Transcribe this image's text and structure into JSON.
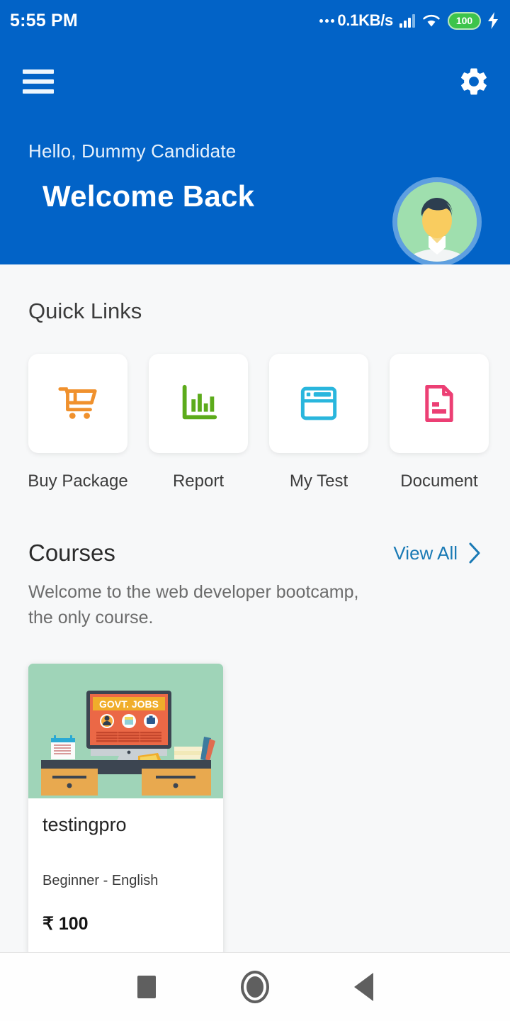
{
  "statusbar": {
    "time": "5:55 PM",
    "network_speed": "0.1KB/s",
    "battery_level": "100",
    "icons": [
      "dots-icon",
      "signal-bars-icon",
      "wifi-icon",
      "battery-icon",
      "charging-bolt-icon"
    ]
  },
  "header": {
    "menu_icon": "hamburger-menu-icon",
    "settings_icon": "gear-icon",
    "greeting": "Hello, Dummy Candidate",
    "title": "Welcome Back",
    "avatar_label": "user-avatar",
    "bg_color": "#0263c7"
  },
  "quick_links": {
    "title": "Quick Links",
    "items": [
      {
        "label": "Buy Package",
        "icon": "shopping-cart-icon",
        "color": "#f0912d"
      },
      {
        "label": "Report",
        "icon": "bar-chart-icon",
        "color": "#5cab1b"
      },
      {
        "label": "My Test",
        "icon": "browser-window-icon",
        "color": "#29b6dd"
      },
      {
        "label": "Document",
        "icon": "document-icon",
        "color": "#ec3f74"
      }
    ]
  },
  "courses": {
    "title": "Courses",
    "view_all_label": "View All",
    "view_all_icon": "chevron-right-icon",
    "description": "Welcome to the web developer bootcamp, the only course.",
    "card": {
      "thumbnail_text": "GOVT. JOBS",
      "name": "testingpro",
      "meta": "Beginner - English",
      "price": "₹ 100"
    }
  },
  "navbar": {
    "items": [
      {
        "label": "recents",
        "icon": "square-icon"
      },
      {
        "label": "home",
        "icon": "circle-home-icon"
      },
      {
        "label": "back",
        "icon": "triangle-back-icon"
      }
    ]
  }
}
